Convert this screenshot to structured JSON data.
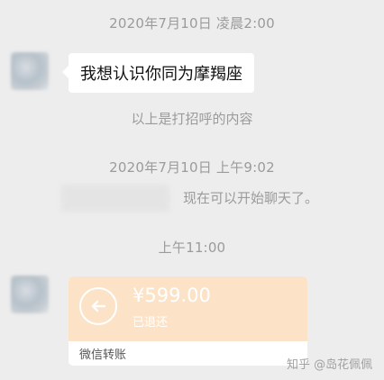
{
  "messages": {
    "timestamp_1": "2020年7月10日 凌晨2:00",
    "greeting_bubble": "我想认识你同为摩羯座",
    "greeting_note": "以上是打招呼的内容",
    "timestamp_2": "2020年7月10日 上午9:02",
    "chat_start_text": "现在可以开始聊天了。",
    "timestamp_3": "上午11:00"
  },
  "transfer": {
    "amount": "¥599.00",
    "status": "已退还",
    "footer": "微信转账",
    "icon": "return-arrow-icon",
    "colors": {
      "card_top": "#fce3c7",
      "text": "#ffffff"
    }
  },
  "watermark": "知乎 @岛花佩佩",
  "colors": {
    "background": "#ededed",
    "bubble": "#ffffff",
    "muted_text": "#9b9b9b"
  }
}
